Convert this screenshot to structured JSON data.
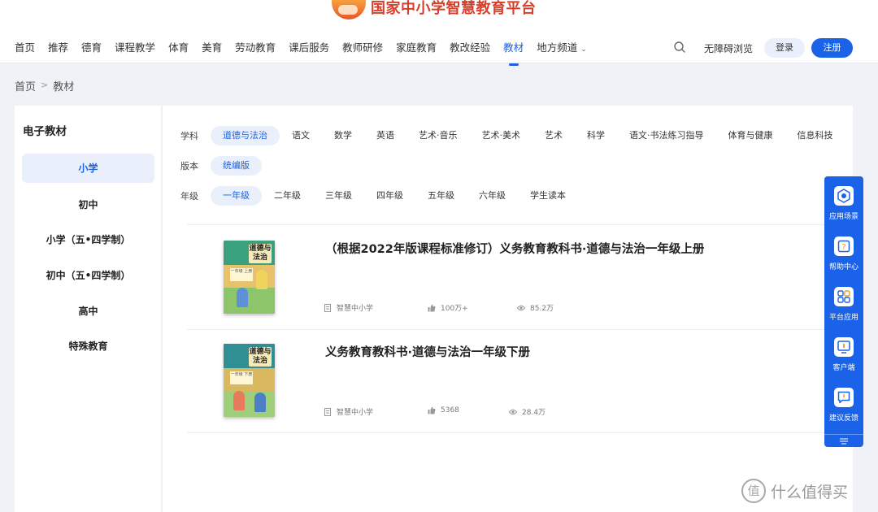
{
  "header": {
    "logo_text": "国家中小学智慧教育平台",
    "nav": [
      {
        "label": "首页"
      },
      {
        "label": "推荐"
      },
      {
        "label": "德育"
      },
      {
        "label": "课程教学"
      },
      {
        "label": "体育"
      },
      {
        "label": "美育"
      },
      {
        "label": "劳动教育"
      },
      {
        "label": "课后服务"
      },
      {
        "label": "教师研修"
      },
      {
        "label": "家庭教育"
      },
      {
        "label": "教改经验"
      },
      {
        "label": "教材",
        "active": true
      },
      {
        "label": "地方频道"
      }
    ],
    "accessibility": "无障碍浏览",
    "login": "登录",
    "register": "注册",
    "accent": "#1a62e8"
  },
  "breadcrumb": {
    "home": "首页",
    "sep": ">",
    "current": "教材"
  },
  "sidebar": {
    "title": "电子教材",
    "items": [
      {
        "label": "小学",
        "active": true
      },
      {
        "label": "初中"
      },
      {
        "label": "小学（五•四学制）"
      },
      {
        "label": "初中（五•四学制）"
      },
      {
        "label": "高中"
      },
      {
        "label": "特殊教育"
      }
    ]
  },
  "filters": {
    "subject": {
      "label": "学科",
      "options": [
        "道德与法治",
        "语文",
        "数学",
        "英语",
        "艺术·音乐",
        "艺术·美术",
        "艺术",
        "科学",
        "语文·书法练习指导",
        "体育与健康",
        "信息科技"
      ],
      "selected": "道德与法治"
    },
    "edition": {
      "label": "版本",
      "options": [
        "统编版"
      ],
      "selected": "统编版"
    },
    "grade": {
      "label": "年级",
      "options": [
        "一年级",
        "二年级",
        "三年级",
        "四年级",
        "五年级",
        "六年级",
        "学生读本"
      ],
      "selected": "一年级"
    }
  },
  "books": [
    {
      "title": "（根据2022年版课程标准修订）义务教育教科书·道德与法治一年级上册",
      "publisher": "智慧中小学",
      "likes": "100万+",
      "views": "85.2万",
      "cover_title": "道德与法治",
      "cover_grade": "一年级 上册"
    },
    {
      "title": "义务教育教科书·道德与法治一年级下册",
      "publisher": "智慧中小学",
      "likes": "5368",
      "views": "28.4万",
      "cover_title": "道德与法治",
      "cover_grade": "一年级 下册"
    }
  ],
  "floating_bar": {
    "items": [
      {
        "label": "应用场景",
        "icon": "apps-scene-icon"
      },
      {
        "label": "帮助中心",
        "icon": "help-icon"
      },
      {
        "label": "平台应用",
        "icon": "grid-apps-icon"
      },
      {
        "label": "客户端",
        "icon": "client-icon"
      },
      {
        "label": "建议反馈",
        "icon": "feedback-icon"
      }
    ]
  },
  "watermark": {
    "mark": "值",
    "text": "什么值得买"
  }
}
